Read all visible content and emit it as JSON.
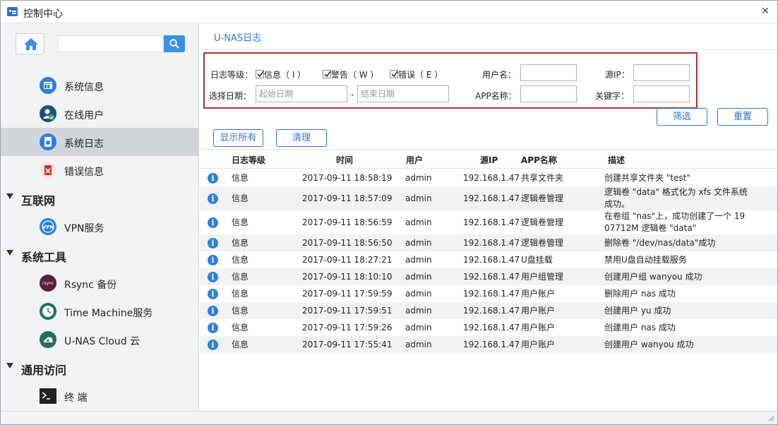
{
  "window": {
    "title": "控制中心",
    "close_glyph": "✕"
  },
  "sidebar": {
    "search_placeholder": "",
    "items": [
      {
        "label": "系统信息",
        "icon": "system-info-icon",
        "color": "#2e7fdb"
      },
      {
        "label": "在线用户",
        "icon": "online-user-icon",
        "color": "#1f4e85"
      },
      {
        "label": "系统日志",
        "icon": "system-log-icon",
        "color": "#2e7fdb"
      },
      {
        "label": "错误信息",
        "icon": "error-info-icon",
        "color": "#c0392b"
      }
    ],
    "sections": [
      {
        "label": "互联网",
        "items": [
          {
            "label": "VPN服务",
            "icon": "vpn-icon",
            "color": "#2e7fdb"
          }
        ]
      },
      {
        "label": "系统工具",
        "items": [
          {
            "label": "Rsync 备份",
            "icon": "rsync-icon",
            "color": "#5a1f3c"
          },
          {
            "label": "Time Machine服务",
            "icon": "time-machine-icon",
            "color": "#1f6f60"
          },
          {
            "label": "U-NAS Cloud 云",
            "icon": "cloud-icon",
            "color": "#1f6f60"
          }
        ]
      },
      {
        "label": "通用访问",
        "items": [
          {
            "label": "终 端",
            "icon": "terminal-icon",
            "color": "#222222"
          }
        ]
      }
    ]
  },
  "content": {
    "title": "U-NAS日志",
    "filter": {
      "level_label": "日志等级：",
      "checkboxes": [
        "信息（ I ）",
        "警告（ W ）",
        "错误（ E ）"
      ],
      "user_label": "用户名：",
      "ip_label": "源IP：",
      "date_label": "选择日期：",
      "start_placeholder": "起始日期",
      "dash": "-",
      "end_placeholder": "结束日期",
      "app_label": "APP名称：",
      "keyword_label": "关键字："
    },
    "buttons": {
      "filter": "筛选",
      "reset": "重置",
      "show_all": "显示所有",
      "clear": "清理"
    },
    "table": {
      "headers": [
        "日志等级",
        "时间",
        "用户",
        "源IP",
        "APP名称",
        "描述"
      ],
      "rows": [
        {
          "level": "信息",
          "time": "2017-09-11 18:58:19",
          "user": "admin",
          "ip": "192.168.1.47",
          "app": "共享文件夹",
          "desc": [
            "创建共享文件夹 \"test\""
          ]
        },
        {
          "level": "信息",
          "time": "2017-09-11 18:57:09",
          "user": "admin",
          "ip": "192.168.1.47",
          "app": "逻辑卷管理",
          "desc": [
            "逻辑卷 \"data\" 格式化为 xfs 文件系统",
            "成功。"
          ]
        },
        {
          "level": "信息",
          "time": "2017-09-11 18:56:59",
          "user": "admin",
          "ip": "192.168.1.47",
          "app": "逻辑卷管理",
          "desc": [
            "在卷组 \"nas\"上，成功创建了一个 19",
            "07712M 逻辑卷 \"data\""
          ]
        },
        {
          "level": "信息",
          "time": "2017-09-11 18:56:50",
          "user": "admin",
          "ip": "192.168.1.47",
          "app": "逻辑卷管理",
          "desc": [
            "删除卷 \"/dev/nas/data\"成功"
          ]
        },
        {
          "level": "信息",
          "time": "2017-09-11 18:27:21",
          "user": "admin",
          "ip": "192.168.1.47",
          "app": "U盘挂载",
          "desc": [
            "禁用U盘自动挂载服务"
          ]
        },
        {
          "level": "信息",
          "time": "2017-09-11 18:10:10",
          "user": "admin",
          "ip": "192.168.1.47",
          "app": "用户组管理",
          "desc": [
            "创建用户组 wanyou 成功"
          ]
        },
        {
          "level": "信息",
          "time": "2017-09-11 17:59:59",
          "user": "admin",
          "ip": "192.168.1.47",
          "app": "用户账户",
          "desc": [
            "删除用户 nas 成功"
          ]
        },
        {
          "level": "信息",
          "time": "2017-09-11 17:59:51",
          "user": "admin",
          "ip": "192.168.1.47",
          "app": "用户账户",
          "desc": [
            "创建用户 yu 成功"
          ]
        },
        {
          "level": "信息",
          "time": "2017-09-11 17:59:26",
          "user": "admin",
          "ip": "192.168.1.47",
          "app": "用户账户",
          "desc": [
            "创建用户 nas 成功"
          ]
        },
        {
          "level": "信息",
          "time": "2017-09-11 17:55:41",
          "user": "admin",
          "ip": "192.168.1.47",
          "app": "用户账户",
          "desc": [
            "创建用户 wanyou 成功"
          ]
        }
      ]
    }
  },
  "colors": {
    "accent": "#2e75c9",
    "filter_border": "#a83232",
    "active_nav": "#d1d5da"
  }
}
